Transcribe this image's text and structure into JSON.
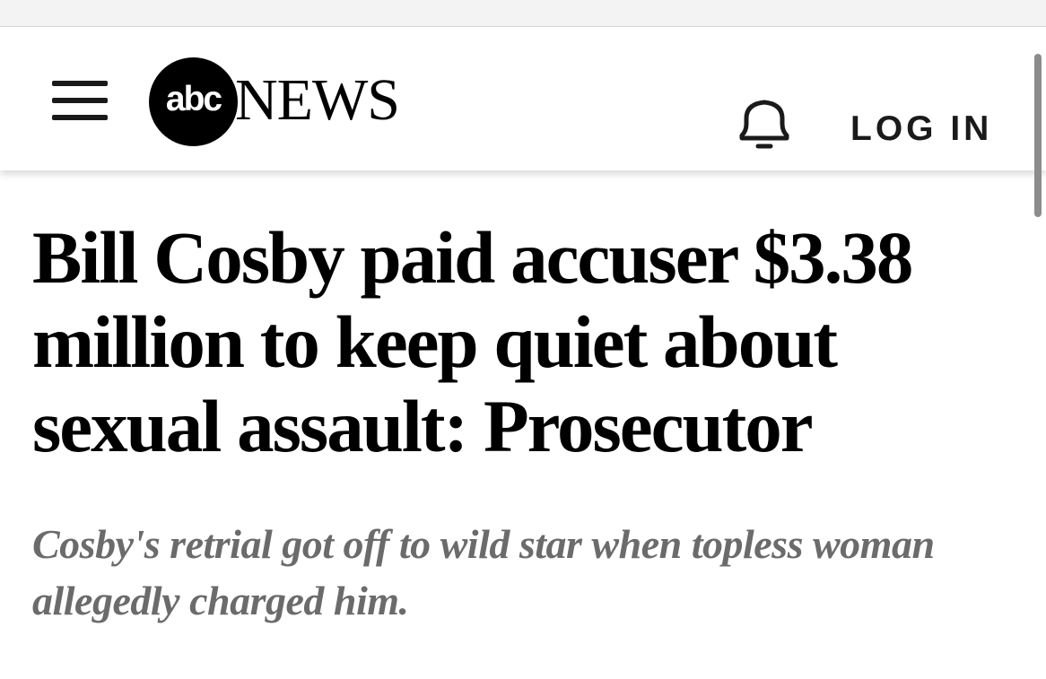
{
  "header": {
    "menu_icon": "hamburger-menu-icon",
    "logo": {
      "circle_text": "abc",
      "wordmark": "NEWS"
    },
    "notifications_icon": "bell-icon",
    "login_label": "LOG IN"
  },
  "article": {
    "headline": "Bill Cosby paid accuser $3.38 million to keep quiet about sexual assault: Prosecutor",
    "subheadline": "Cosby's retrial got off to wild star when topless woman allegedly charged him."
  },
  "colors": {
    "headline_text": "#000000",
    "subheadline_text": "#6b6b6b",
    "top_strip": "#f3f3f3"
  }
}
